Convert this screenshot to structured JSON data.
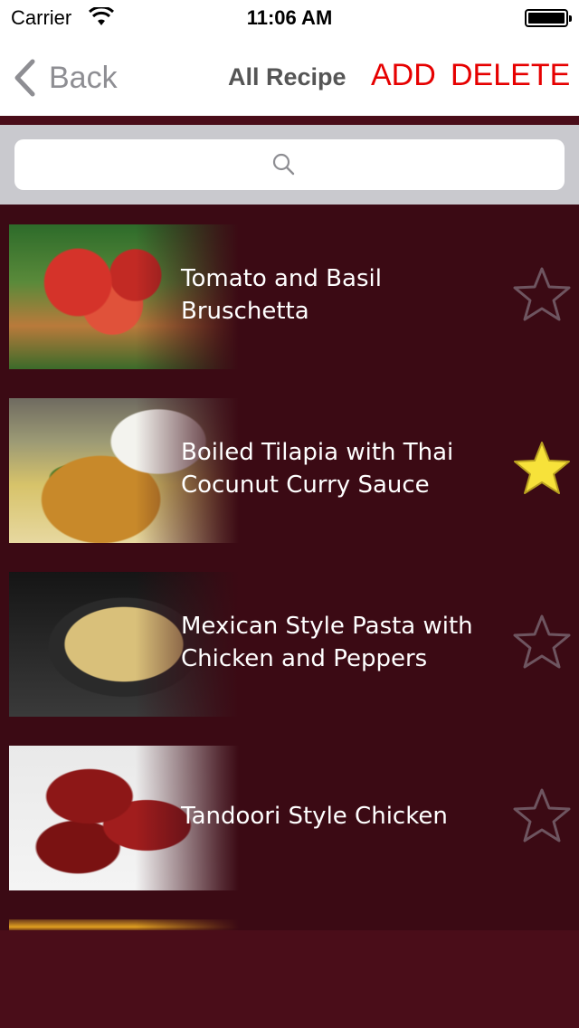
{
  "status_bar": {
    "carrier": "Carrier",
    "time": "11:06 AM"
  },
  "nav": {
    "back_label": "Back",
    "title": "All Recipe",
    "add_label": "ADD",
    "delete_label": "DELETE"
  },
  "search": {
    "placeholder": ""
  },
  "recipes": [
    {
      "title": "Tomato and Basil Bruschetta",
      "favorite": false
    },
    {
      "title": "Boiled Tilapia with Thai Cocunut Curry Sauce",
      "favorite": true
    },
    {
      "title": "Mexican Style Pasta with Chicken and Peppers",
      "favorite": false
    },
    {
      "title": "Tandoori Style Chicken",
      "favorite": false
    }
  ],
  "colors": {
    "accent": "#e60000",
    "list_background": "#3b0a14",
    "star_filled": "#f7e23a",
    "star_outline": "#6e5560"
  }
}
